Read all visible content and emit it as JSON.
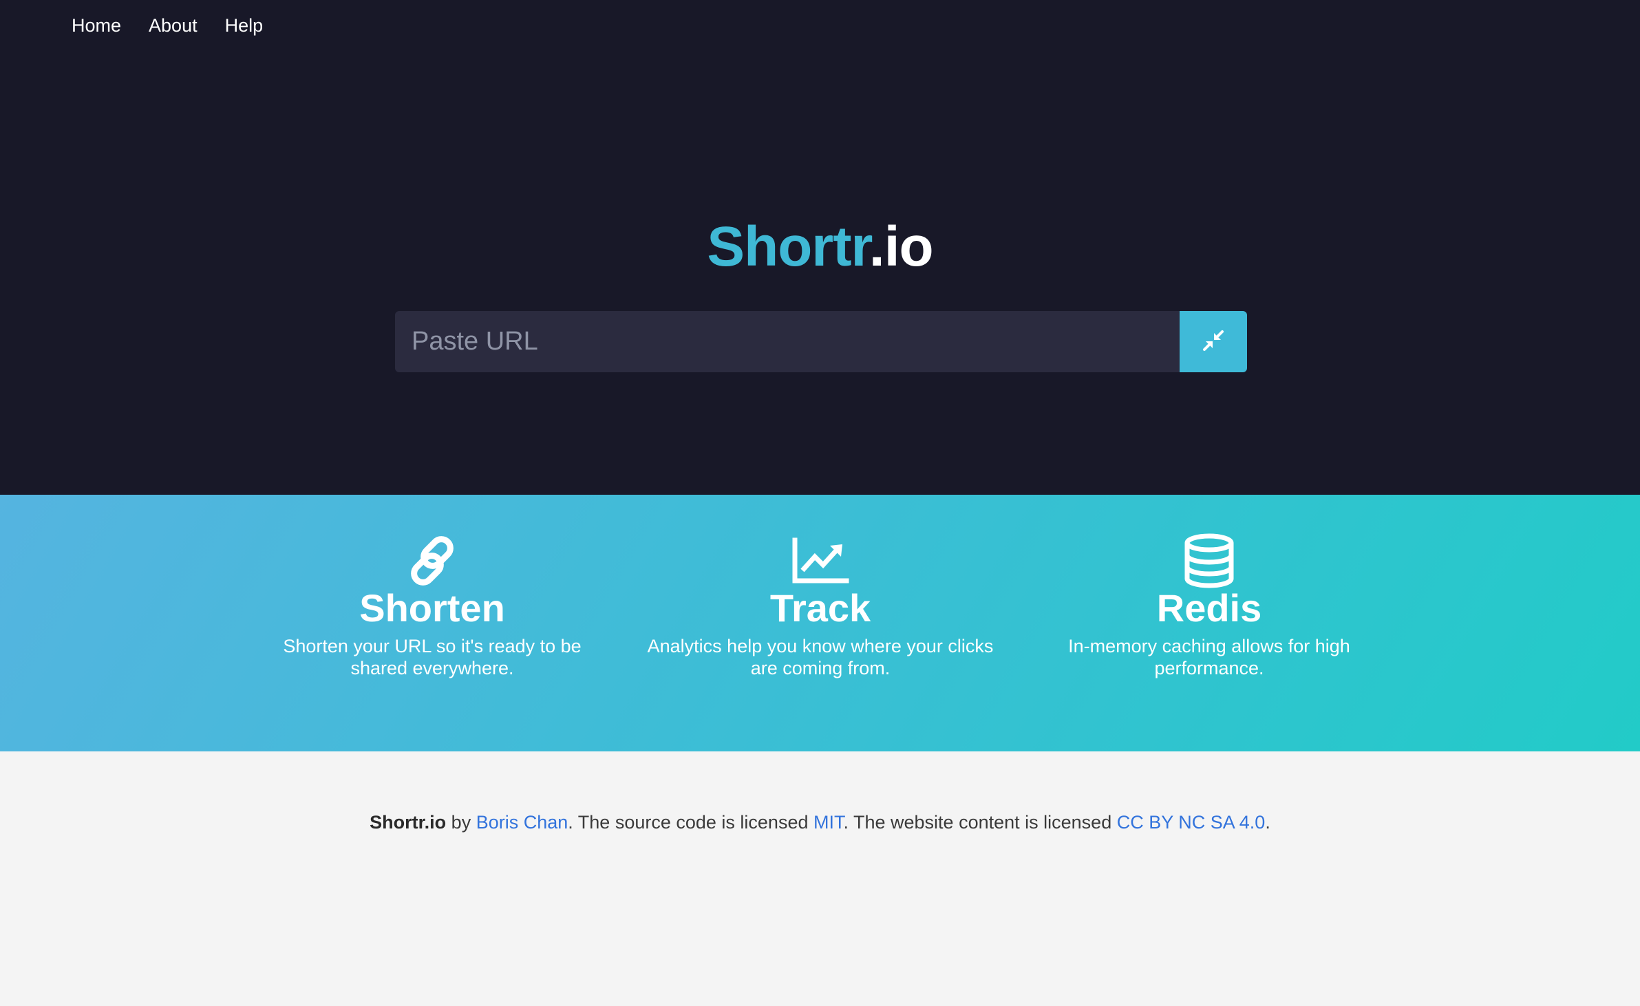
{
  "nav": {
    "items": [
      {
        "label": "Home"
      },
      {
        "label": "About"
      },
      {
        "label": "Help"
      }
    ]
  },
  "brand": {
    "main": "Shortr",
    "tld": ".io"
  },
  "search": {
    "placeholder": "Paste URL",
    "value": "",
    "button_icon": "compress-arrows-icon"
  },
  "features": [
    {
      "icon": "link-icon",
      "title": "Shorten",
      "description": "Shorten your URL so it's ready to be shared everywhere."
    },
    {
      "icon": "chart-line-icon",
      "title": "Track",
      "description": "Analytics help you know where your clicks are coming from."
    },
    {
      "icon": "database-icon",
      "title": "Redis",
      "description": "In-memory caching allows for high performance."
    }
  ],
  "footer": {
    "brand": "Shortr.io",
    "by": " by ",
    "author": "Boris Chan",
    "text1": ". The source code is licensed ",
    "code_license": "MIT",
    "text2": ". The website content is licensed ",
    "content_license": "CC BY NC SA 4.0",
    "end": "."
  },
  "colors": {
    "hero_bg": "#181828",
    "accent": "#3fb8d5",
    "input_bg": "#2b2b3f",
    "link": "#3273dc",
    "footer_bg": "#f4f4f4"
  }
}
